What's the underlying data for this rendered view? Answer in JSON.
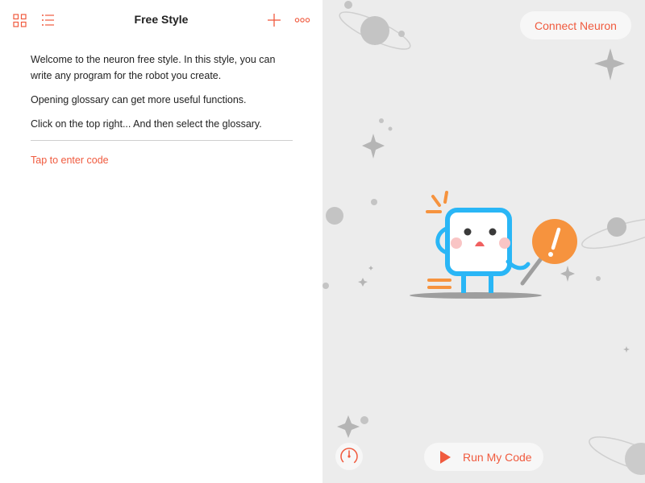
{
  "toolbar": {
    "title": "Free Style",
    "icons": [
      "grid-icon",
      "list-icon",
      "plus-icon",
      "more-icon"
    ]
  },
  "intro": {
    "paragraphs": [
      "Welcome to the neuron free style. In this style, you can write any program for the robot you create.",
      "Opening glossary can get more useful functions.",
      "Click on the top right... And then select the glossary."
    ],
    "tap_to_enter": "Tap to enter code"
  },
  "stage": {
    "connect_label": "Connect Neuron",
    "run_label": "Run My Code",
    "speed_icon": "speedometer-icon",
    "illustration": "neuron-robot-holding-warning-sign",
    "colors": {
      "accent": "#f05a3e",
      "robot": "#29b6f6",
      "warning": "#f6933e",
      "background": "#ececec"
    }
  }
}
